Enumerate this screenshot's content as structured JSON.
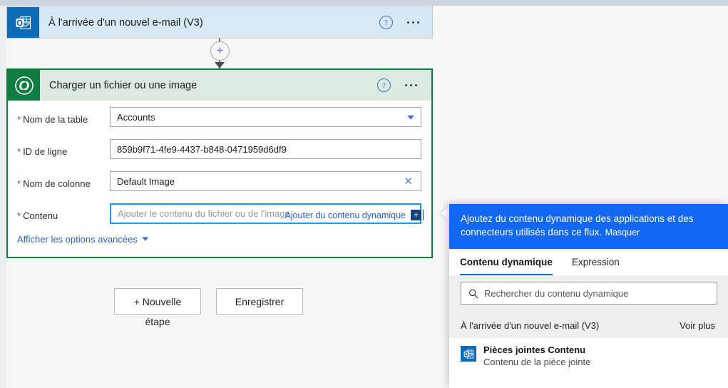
{
  "canvas": {
    "trigger_card": {
      "title": "À l'arrivée d'un nouvel e-mail (V3)",
      "icon": "outlook-icon",
      "help_label": "?",
      "accent_color": "#0d6cb9",
      "background_color": "#d6e7f6"
    },
    "connector": {
      "add_label": "+"
    },
    "action_card": {
      "title": "Charger un fichier ou une image",
      "icon": "dataverse-icon",
      "help_label": "?",
      "accent_color": "#107c41",
      "background_color": "#dbe9e0",
      "fields": [
        {
          "label": "Nom de la table",
          "required": true,
          "value": "Accounts",
          "placeholder": "",
          "trailing_icon": "chevron-down-icon",
          "focused": false
        },
        {
          "label": "ID de ligne",
          "required": true,
          "value": "859b9f71-4fe9-4437-b848-0471959d6df9",
          "placeholder": "",
          "trailing_icon": "",
          "focused": false
        },
        {
          "label": "Nom de colonne",
          "required": true,
          "value": "Default Image",
          "placeholder": "",
          "trailing_icon": "clear-icon",
          "focused": false
        },
        {
          "label": "Contenu",
          "required": true,
          "value": "",
          "placeholder": "Ajouter le contenu du fichier ou de l'image",
          "trailing_icon": "",
          "focused": true
        }
      ],
      "dynamic_content_link": "Ajouter du contenu dynamique",
      "dynamic_content_badge": "+",
      "advanced_options_label": "Afficher les options avancées"
    },
    "buttons": {
      "new_step": "+ Nouvelle",
      "new_step_overflow": "étape",
      "save": "Enregistrer"
    }
  },
  "flyout": {
    "header_text": "Ajoutez du contenu dynamique des applications et des connecteurs utilisés dans ce flux.",
    "hide_link": "Masquer",
    "header_color": "#1268f2",
    "tabs": [
      {
        "label": "Contenu dynamique",
        "active": true
      },
      {
        "label": "Expression",
        "active": false
      }
    ],
    "search": {
      "placeholder": "Rechercher du contenu dynamique",
      "icon": "search-icon"
    },
    "groups": [
      {
        "name": "À l'arrivée d'un nouvel e-mail (V3)",
        "more_label": "Voir plus",
        "items": [
          {
            "title": "Pièces jointes Contenu",
            "subtitle": "Contenu de la pièce jointe",
            "icon": "outlook-icon"
          }
        ]
      }
    ]
  }
}
